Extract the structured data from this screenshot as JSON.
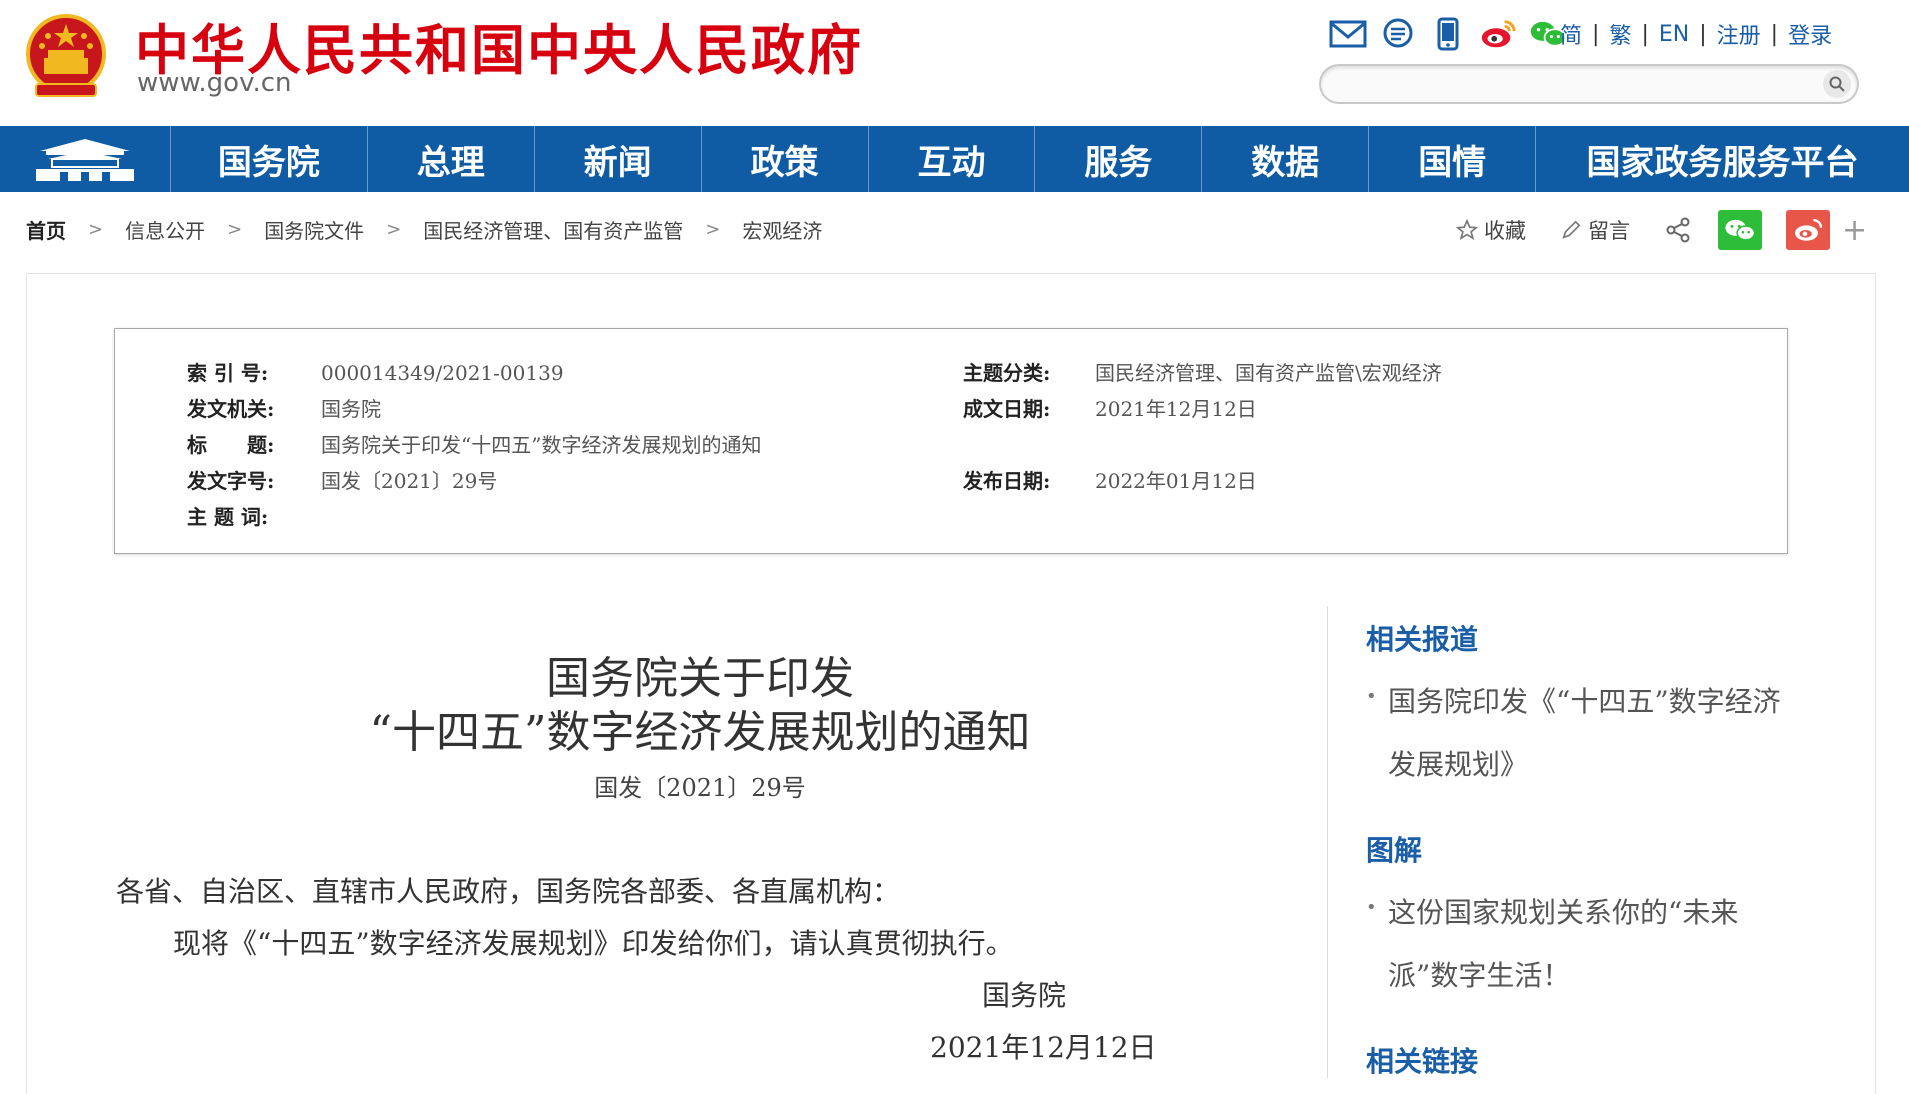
{
  "header": {
    "title": "中华人民共和国中央人民政府",
    "domain": "www.gov.cn",
    "icons": [
      "mail-icon",
      "message-icon",
      "mobile-icon",
      "weibo-icon",
      "wechat-icon"
    ],
    "lang_links": [
      "简",
      "繁",
      "EN"
    ],
    "register": "注册",
    "login": "登录",
    "search_placeholder": ""
  },
  "nav": {
    "items": [
      "国务院",
      "总理",
      "新闻",
      "政策",
      "互动",
      "服务",
      "数据",
      "国情",
      "国家政务服务平台"
    ]
  },
  "breadcrumb": [
    "首页",
    "信息公开",
    "国务院文件",
    "国民经济管理、国有资产监管",
    "宏观经济"
  ],
  "tools": {
    "favorite": "收藏",
    "comment": "留言",
    "plus": "+"
  },
  "meta": {
    "index_label": "索 引 号:",
    "index_value": "000014349/2021-00139",
    "issuer_label": "发文机关:",
    "issuer_value": "国务院",
    "title_label": "标　　题:",
    "title_value": "国务院关于印发“十四五”数字经济发展规划的通知",
    "docno_label": "发文字号:",
    "docno_value": "国发〔2021〕29号",
    "keywords_label": "主 题 词:",
    "category_label": "主题分类:",
    "category_value": "国民经济管理、国有资产监管\\宏观经济",
    "written_label": "成文日期:",
    "written_value": "2021年12月12日",
    "published_label": "发布日期:",
    "published_value": "2022年01月12日"
  },
  "article": {
    "title_line1": "国务院关于印发",
    "title_line2": "“十四五”数字经济发展规划的通知",
    "doc_number": "国发〔2021〕29号",
    "salutation": "各省、自治区、直辖市人民政府，国务院各部委、各直属机构：",
    "paragraph1": "现将《“十四五”数字经济发展规划》印发给你们，请认真贯彻执行。",
    "signature": "国务院",
    "date": "2021年12月12日"
  },
  "sidebar": {
    "related_reports_heading": "相关报道",
    "related_reports_link": "国务院印发《“十四五”数字经济发展规划》",
    "graphics_heading": "图解",
    "graphics_link": "这份国家规划关系你的“未来派”数字生活！",
    "related_links_heading": "相关链接",
    "bullet": "•"
  },
  "colors": {
    "brand_red": "#d7000f",
    "nav_blue": "#0f5ba4",
    "link_blue": "#1a5ea8",
    "wechat_green": "#2dbd38",
    "weibo_red": "#e8564a"
  }
}
